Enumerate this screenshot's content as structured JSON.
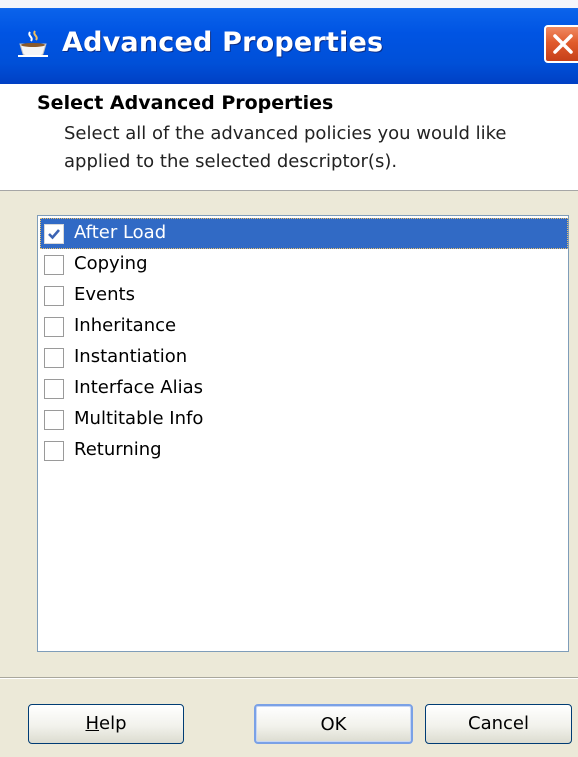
{
  "window": {
    "title": "Advanced Properties",
    "icon": "coffee-cup-icon",
    "close_icon": "close-icon"
  },
  "header": {
    "title": "Select Advanced Properties",
    "description": "Select all of the advanced policies you would like applied to the selected descriptor(s)."
  },
  "policies": [
    {
      "label": "After Load",
      "checked": true,
      "selected": true
    },
    {
      "label": "Copying",
      "checked": false,
      "selected": false
    },
    {
      "label": "Events",
      "checked": false,
      "selected": false
    },
    {
      "label": "Inheritance",
      "checked": false,
      "selected": false
    },
    {
      "label": "Instantiation",
      "checked": false,
      "selected": false
    },
    {
      "label": "Interface Alias",
      "checked": false,
      "selected": false
    },
    {
      "label": "Multitable Info",
      "checked": false,
      "selected": false
    },
    {
      "label": "Returning",
      "checked": false,
      "selected": false
    }
  ],
  "buttons": {
    "help_mnemonic": "H",
    "help_rest": "elp",
    "ok": "OK",
    "cancel": "Cancel"
  },
  "colors": {
    "title_bar": "#0054e3",
    "selection": "#316ac5",
    "close_button": "#e15b2c",
    "check_mark": "#3c64b4"
  }
}
